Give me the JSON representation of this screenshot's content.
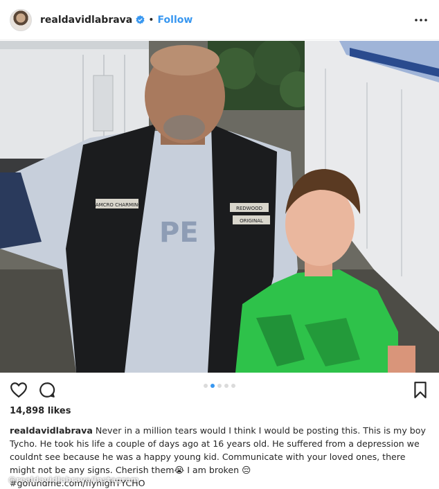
{
  "post": {
    "username": "realdavidlabrava",
    "separator": "•",
    "follow_label": "Follow",
    "likes": "14,898 likes",
    "caption_username": "realdavidlabrava",
    "caption_text": "Never in a million tears would I think I would be posting this. This is my boy Tycho. He took his life a couple of days ago at 16 years old. He suffered from a depression we couldnt see because he was a happy young kid. Communicate with your loved ones, there might not be any signs. Cherish them😭 I am broken 😔",
    "caption_hashtag": "#gofundme.com/flyhighTYCHO",
    "carousel_total": 5,
    "carousel_active": 1
  },
  "patches": {
    "vest_left": "SAMCRO CHARMING",
    "vest_right_top": "REDWOOD",
    "vest_right_bottom": "ORIGINAL"
  },
  "watermark": "@realdavidlabrava/Instagram",
  "icons": {
    "verified": "verified-badge-icon",
    "more": "more-options-icon",
    "like": "heart-icon",
    "comment": "comment-bubble-icon",
    "save": "bookmark-icon"
  },
  "colors": {
    "link": "#3897f0",
    "text": "#262626",
    "divider": "#efefef"
  }
}
